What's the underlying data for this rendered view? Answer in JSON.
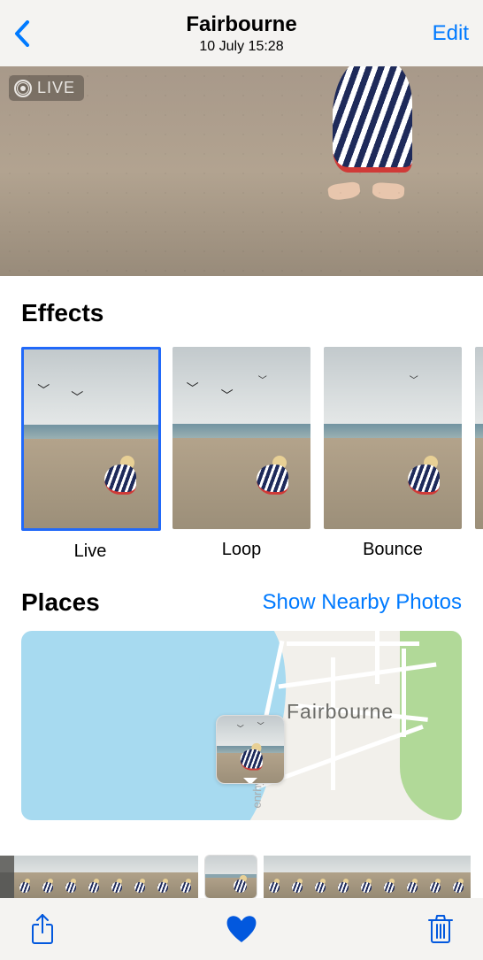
{
  "header": {
    "title": "Fairbourne",
    "subtitle": "10 July  15:28",
    "edit_label": "Edit"
  },
  "live_badge": "LIVE",
  "effects": {
    "title": "Effects",
    "items": [
      {
        "label": "Live",
        "selected": true
      },
      {
        "label": "Loop",
        "selected": false
      },
      {
        "label": "Bounce",
        "selected": false
      }
    ]
  },
  "places": {
    "title": "Places",
    "link_label": "Show Nearby Photos",
    "map_label": "Fairbourne",
    "map_label2": "enrhyn"
  },
  "icons": {
    "share": "share-icon",
    "heart": "heart-icon",
    "trash": "trash-icon",
    "back": "chevron-left-icon"
  },
  "colors": {
    "accent": "#007aff",
    "toolbar": "#0258de"
  }
}
